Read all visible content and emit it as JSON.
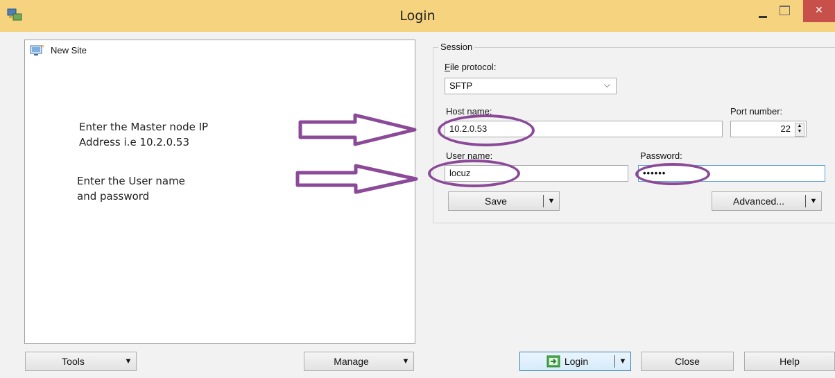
{
  "window": {
    "title": "Login"
  },
  "sites": {
    "items": [
      {
        "label": "New Site"
      }
    ]
  },
  "annotations": {
    "master_ip_line1": "Enter the Master node IP",
    "master_ip_line2": "Address i.e 10.2.0.53",
    "credentials_line1": "Enter the User name",
    "credentials_line2": "and password"
  },
  "session": {
    "group_label": "Session",
    "file_protocol": {
      "label_key": "F",
      "label_rest": "ile protocol:",
      "value": "SFTP"
    },
    "host": {
      "label": "Host name:",
      "value": "10.2.0.53"
    },
    "port": {
      "label": "Port number:",
      "value": "22"
    },
    "user": {
      "label": "User name:",
      "value": "locuz"
    },
    "password": {
      "label": "Password:",
      "value": "••••••"
    },
    "save_button": "Save",
    "advanced_button": "Advanced..."
  },
  "footer": {
    "tools_button": "Tools",
    "manage_button": "Manage",
    "login_button": "Login",
    "close_button": "Close",
    "help_button": "Help"
  },
  "icons": {
    "app": "winscp-app-icon",
    "site": "computer-site-icon",
    "login": "login-icon"
  },
  "colors": {
    "titlebar": "#f6d37f",
    "annotation": "#8b4a98",
    "close_button": "#c7504a"
  }
}
